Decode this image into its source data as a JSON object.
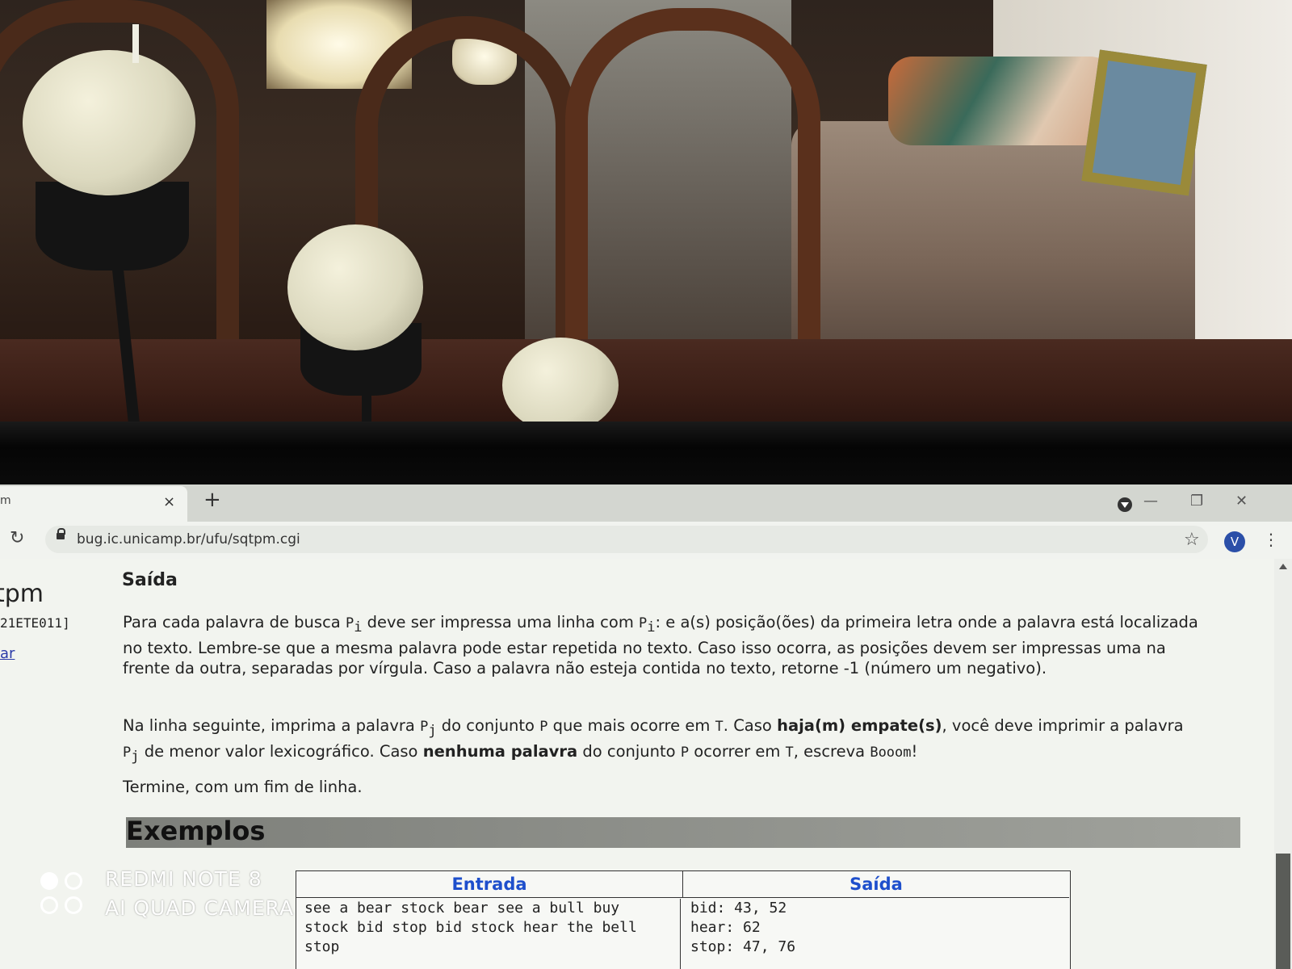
{
  "browser": {
    "tab_title": "m",
    "tab_close": "×",
    "new_tab": "+",
    "url": "bug.ic.unicamp.br/ufu/sqtpm.cgi",
    "avatar_letter": "V",
    "window_controls": {
      "minimize": "—",
      "restore": "❐",
      "close": "✕"
    },
    "reload_icon": "↻",
    "bookmark_icon": "☆",
    "menu_icon": "⋮"
  },
  "sidebar": {
    "title": "tpm",
    "code": "21ETE011]",
    "link": "ar"
  },
  "content": {
    "heading": "Saída",
    "p1": {
      "a": "Para cada palavra de busca ",
      "p": "P",
      "sub": "i",
      "b": " deve ser impressa uma linha com ",
      "p2": "P",
      "sub2": "i",
      "c": ": e a(s) posição(ões) da primeira letra onde a palavra está localizada no texto. Lembre-se que a mesma palavra pode estar repetida no texto. Caso isso ocorra, as posições devem ser impressas uma na frente da outra, separadas por vírgula. Caso a palavra não esteja contida no texto, retorne -1 (número um negativo)."
    },
    "p2": {
      "a": "Na linha seguinte, imprima a palavra ",
      "p": "P",
      "sub": "j",
      "b": " do conjunto ",
      "set": "P",
      "c": " que mais ocorre em ",
      "t": "T",
      "d": ". Caso ",
      "bold1": "haja(m) empate(s)",
      "e": ", você deve imprimir a palavra ",
      "p2": "P",
      "sub2": "j",
      "f": " de menor valor lexicográfico. Caso ",
      "bold2": "nenhuma palavra",
      "g": " do conjunto ",
      "set2": "P",
      "h": " ocorrer em ",
      "t2": "T",
      "i": ", escreva ",
      "boom": "Booom",
      "j": "!"
    },
    "p3": "Termine, com um fim de linha.",
    "examples_heading": "Exemplos",
    "table": {
      "head_in": "Entrada",
      "head_out": "Saída",
      "input_text": "see a bear stock bear see a bull buy\nstock bid stop bid stock hear the bell\nstop",
      "output_text": "bid: 43, 52\nhear: 62\nstop: 47, 76"
    }
  },
  "watermark": {
    "line1": "REDMI NOTE 8",
    "line2": "AI QUAD CAMERA"
  },
  "colors": {
    "link": "#2a3aa8",
    "table_header": "#1e4fcc",
    "avatar": "#2b4fa8"
  }
}
